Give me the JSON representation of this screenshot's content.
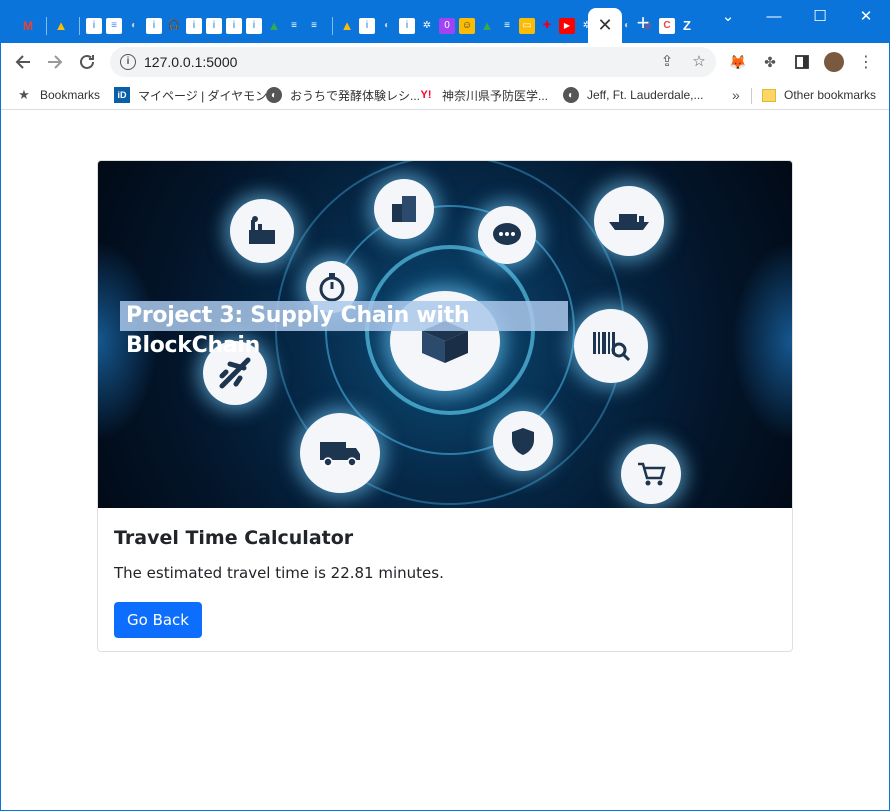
{
  "browser": {
    "address_url": "127.0.0.1:5000",
    "active_tab_close": "✕",
    "new_tab": "+",
    "window_controls": {
      "minimize": "—",
      "maximize": "☐",
      "close": "✕",
      "menu": "⌄"
    },
    "tab_icons": [
      "gmail-icon",
      "drive-icon",
      "doc-icon",
      "doc-icon",
      "doc-icon",
      "page-icon",
      "page-icon",
      "headphones-icon",
      "page-icon",
      "page-icon",
      "page-icon",
      "page-icon",
      "drive-icon",
      "doc-icon",
      "doc-icon",
      "drive-icon",
      "page-icon",
      "page-icon",
      "page-icon",
      "openai-icon",
      "page-icon",
      "smile-icon",
      "drive-icon",
      "doc-icon",
      "note-icon",
      "pin-icon",
      "youtube-icon",
      "openai-icon",
      "colors-icon",
      "page-icon",
      "chrome-icon",
      "cursor-icon",
      "zoom-icon"
    ]
  },
  "bookmarks": {
    "items": [
      {
        "label": "Bookmarks",
        "icon": "star-icon"
      },
      {
        "label": "マイページ | ダイヤモン...",
        "icon": "id-icon"
      },
      {
        "label": "おうちで発酵体験レシ...",
        "icon": "globe-icon"
      },
      {
        "label": "神奈川県予防医学...",
        "icon": "yahoo-icon"
      },
      {
        "label": "Jeff, Ft. Lauderdale,...",
        "icon": "globe-icon"
      }
    ],
    "overflow": "»",
    "other": "Other bookmarks"
  },
  "page": {
    "hero_text": "Project 3: Supply Chain with BlockChain",
    "card_title": "Travel Time Calculator",
    "card_text": "The estimated travel time is 22.81 minutes.",
    "button_label": "Go Back",
    "accent_color": "#0d6efd"
  }
}
